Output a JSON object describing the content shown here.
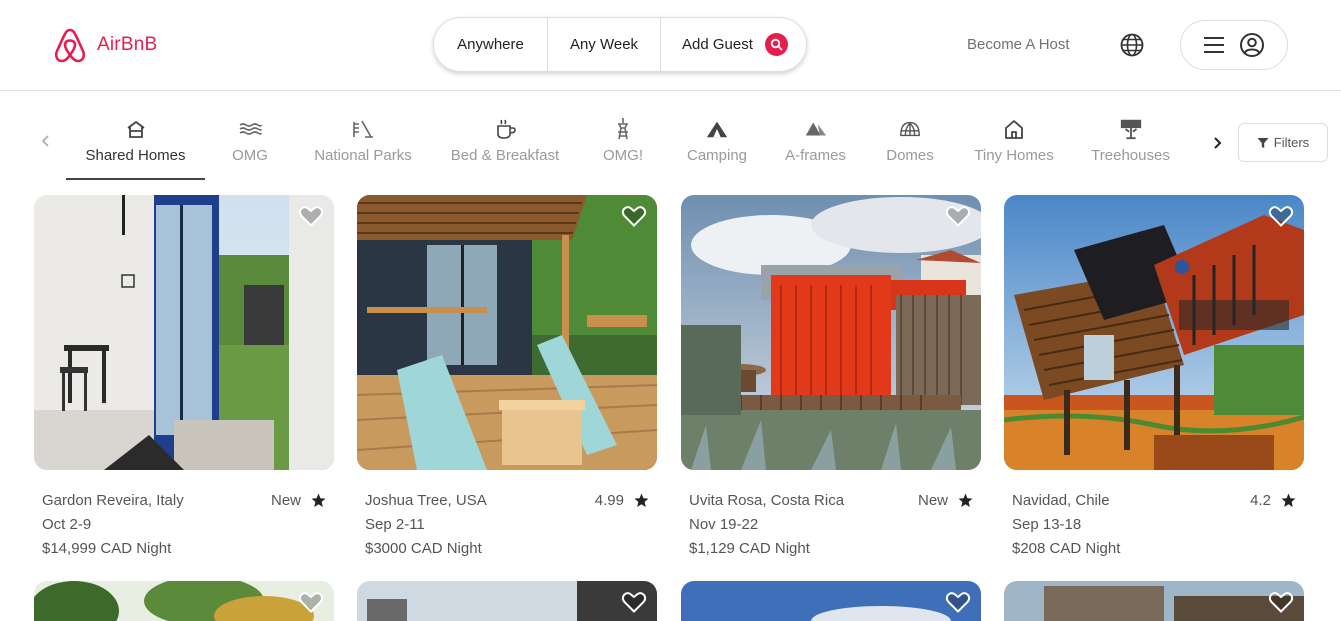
{
  "brand": {
    "name": "AirBnB",
    "color": "#e61e4d"
  },
  "search": {
    "where": "Anywhere",
    "when": "Any Week",
    "who": "Add Guest",
    "icon": "search-icon"
  },
  "nav": {
    "become_host": "Become A Host",
    "globe_icon": "globe-icon",
    "menu_icon": "hamburger-icon",
    "avatar_icon": "user-avatar-icon"
  },
  "categories": [
    {
      "label": "Shared Homes",
      "icon": "house-icon",
      "active": true
    },
    {
      "label": "OMG",
      "icon": "waves-icon"
    },
    {
      "label": "National Parks",
      "icon": "park-icon"
    },
    {
      "label": "Bed & Breakfast",
      "icon": "coffee-icon"
    },
    {
      "label": "OMG!",
      "icon": "tower-icon"
    },
    {
      "label": "Camping",
      "icon": "tent-icon"
    },
    {
      "label": "A-frames",
      "icon": "a-frame-icon"
    },
    {
      "label": "Domes",
      "icon": "dome-icon"
    },
    {
      "label": "Tiny Homes",
      "icon": "tiny-home-icon"
    },
    {
      "label": "Treehouses",
      "icon": "treehouse-icon"
    }
  ],
  "filters_label": "Filters",
  "listings": [
    {
      "location": "Gardon Reveira, Italy",
      "rating": "New",
      "dates": "Oct 2-9",
      "price": "$14,999 CAD Night"
    },
    {
      "location": "Joshua Tree, USA",
      "rating": "4.99",
      "dates": "Sep 2-11",
      "price": "$3000 CAD Night"
    },
    {
      "location": "Uvita Rosa, Costa Rica",
      "rating": "New",
      "dates": "Nov 19-22",
      "price": "$1,129 CAD Night"
    },
    {
      "location": "Navidad, Chile",
      "rating": "4.2",
      "dates": "Sep 13-18",
      "price": "$208 CAD Night"
    }
  ]
}
